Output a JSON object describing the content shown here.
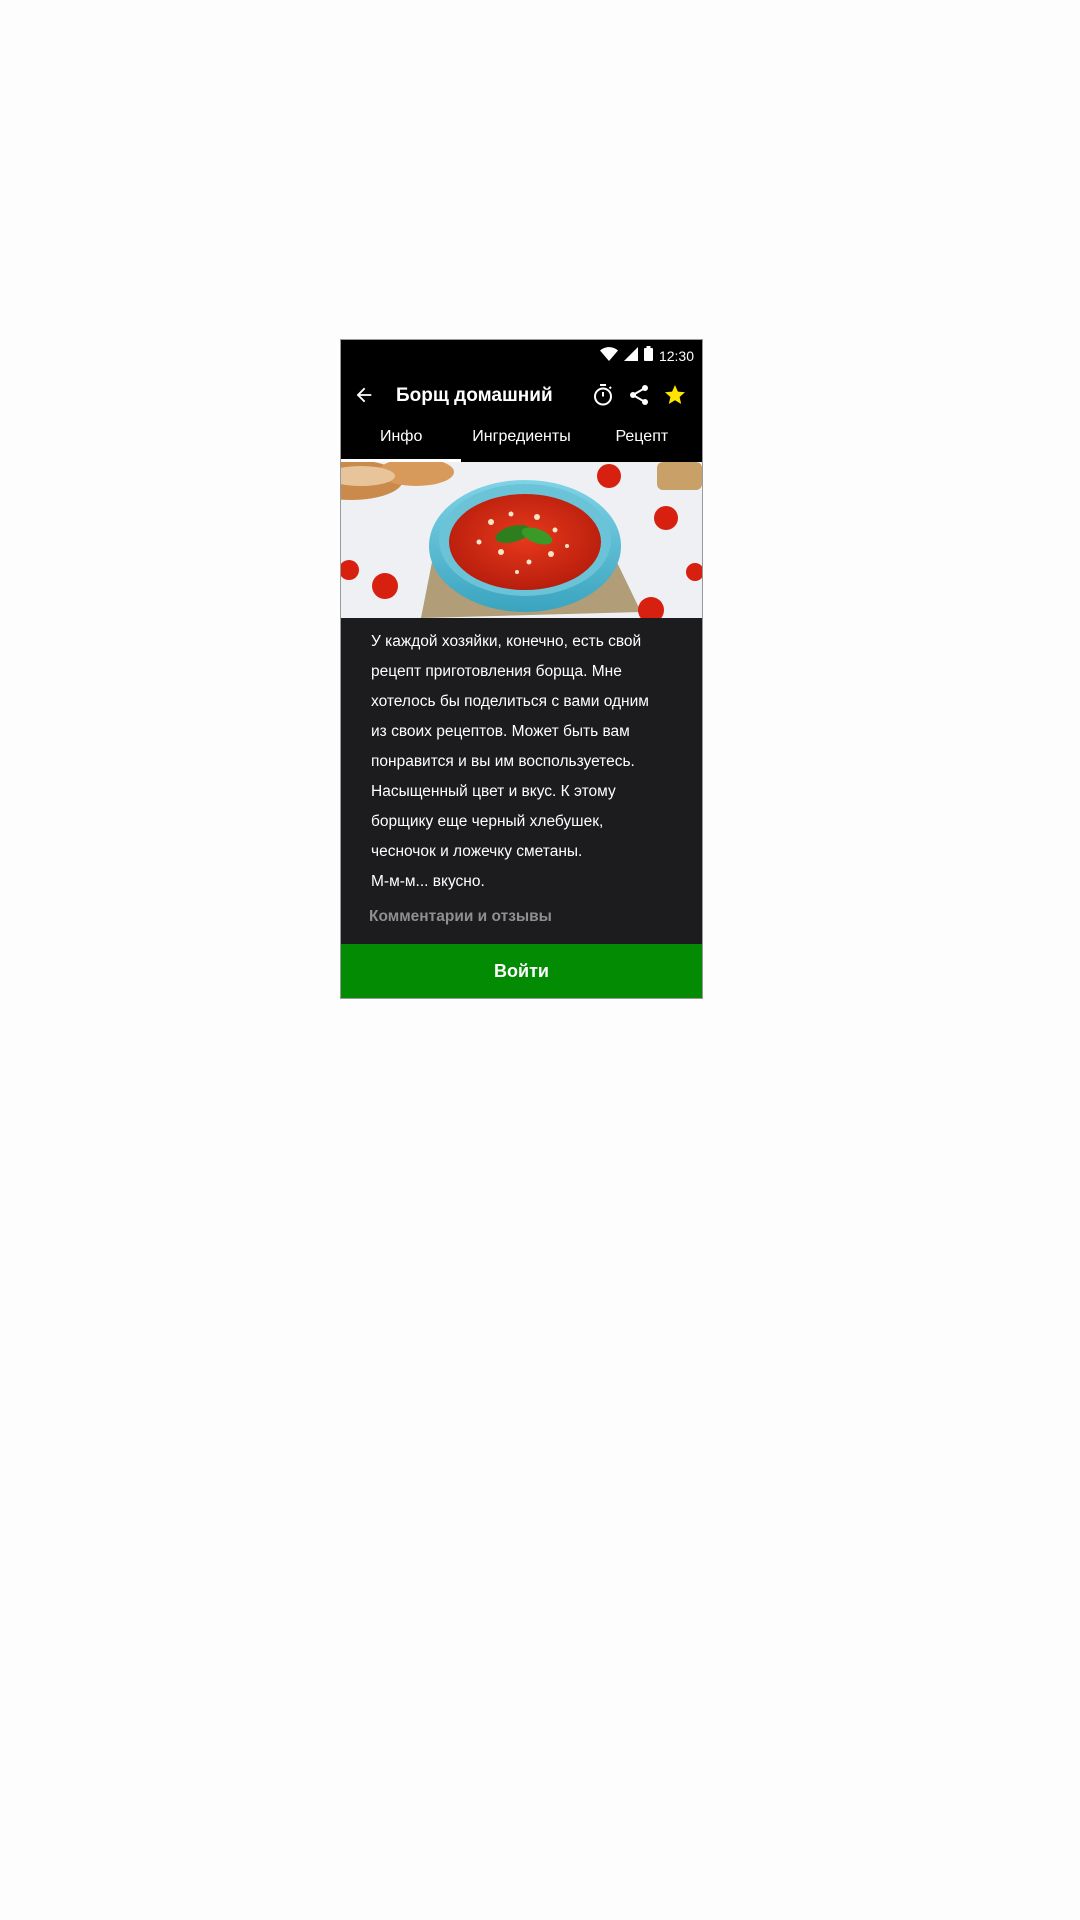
{
  "status_bar": {
    "time": "12:30",
    "icons": [
      "wifi-icon",
      "signal-icon",
      "battery-icon"
    ]
  },
  "toolbar": {
    "back_icon": "arrow-left-icon",
    "title": "Борщ домашний",
    "actions": [
      "timer-icon",
      "share-icon",
      "star-icon"
    ],
    "star_color": "#ffe400"
  },
  "tabs": [
    {
      "label": "Инфо",
      "active": true
    },
    {
      "label": "Ингредиенты",
      "active": false
    },
    {
      "label": "Рецепт",
      "active": false
    }
  ],
  "hero_image": {
    "subject": "tomato-soup-photo"
  },
  "description": "У каждой хозяйки, конечно, есть свой\nрецепт приготовления борща. Мне\nхотелось бы поделиться с вами одним\nиз своих рецептов. Может быть вам\nпонравится и вы им воспользуетесь.\nНасыщенный цвет и вкус. К этому\nборщику еще черный хлебушек,\nчесночок и ложечку сметаны.\nМ-м-м... вкусно.",
  "comments_label": "Комментарии и отзывы",
  "login_button": {
    "label": "Войти",
    "color": "#038b03"
  }
}
